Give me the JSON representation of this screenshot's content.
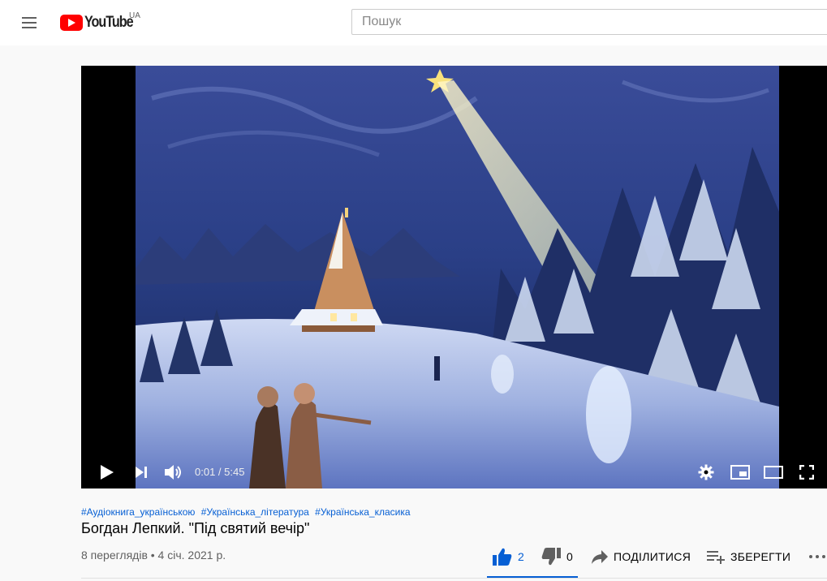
{
  "masthead": {
    "logo_text": "YouTube",
    "region": "UA",
    "search_placeholder": "Пошук"
  },
  "player": {
    "current_time": "0:01",
    "duration": "5:45",
    "time_display": "0:01 / 5:45",
    "progress_fraction": 0.003,
    "buffered_fraction": 0.087,
    "controls": [
      "play-icon",
      "next-icon",
      "volume-icon",
      "settings-icon",
      "miniplayer-icon",
      "theater-mode-icon",
      "fullscreen-icon"
    ]
  },
  "video": {
    "hashtags": [
      "#Аудіокнига_українською",
      "#Українська_література",
      "#Українська_класика"
    ],
    "title": "Богдан Лепкий. \"Під святий вечір\"",
    "meta": "8 переглядів • 4 січ. 2021 р."
  },
  "actions": {
    "like_count": "2",
    "dislike_count": "0",
    "share_label": "ПОДІЛИТИСЯ",
    "save_label": "ЗБЕРЕГТИ",
    "accent_color": "#065fd4"
  },
  "colors": {
    "brand_red": "#ff0000",
    "progress_red": "#ff0000",
    "link_blue": "#065fd4"
  }
}
